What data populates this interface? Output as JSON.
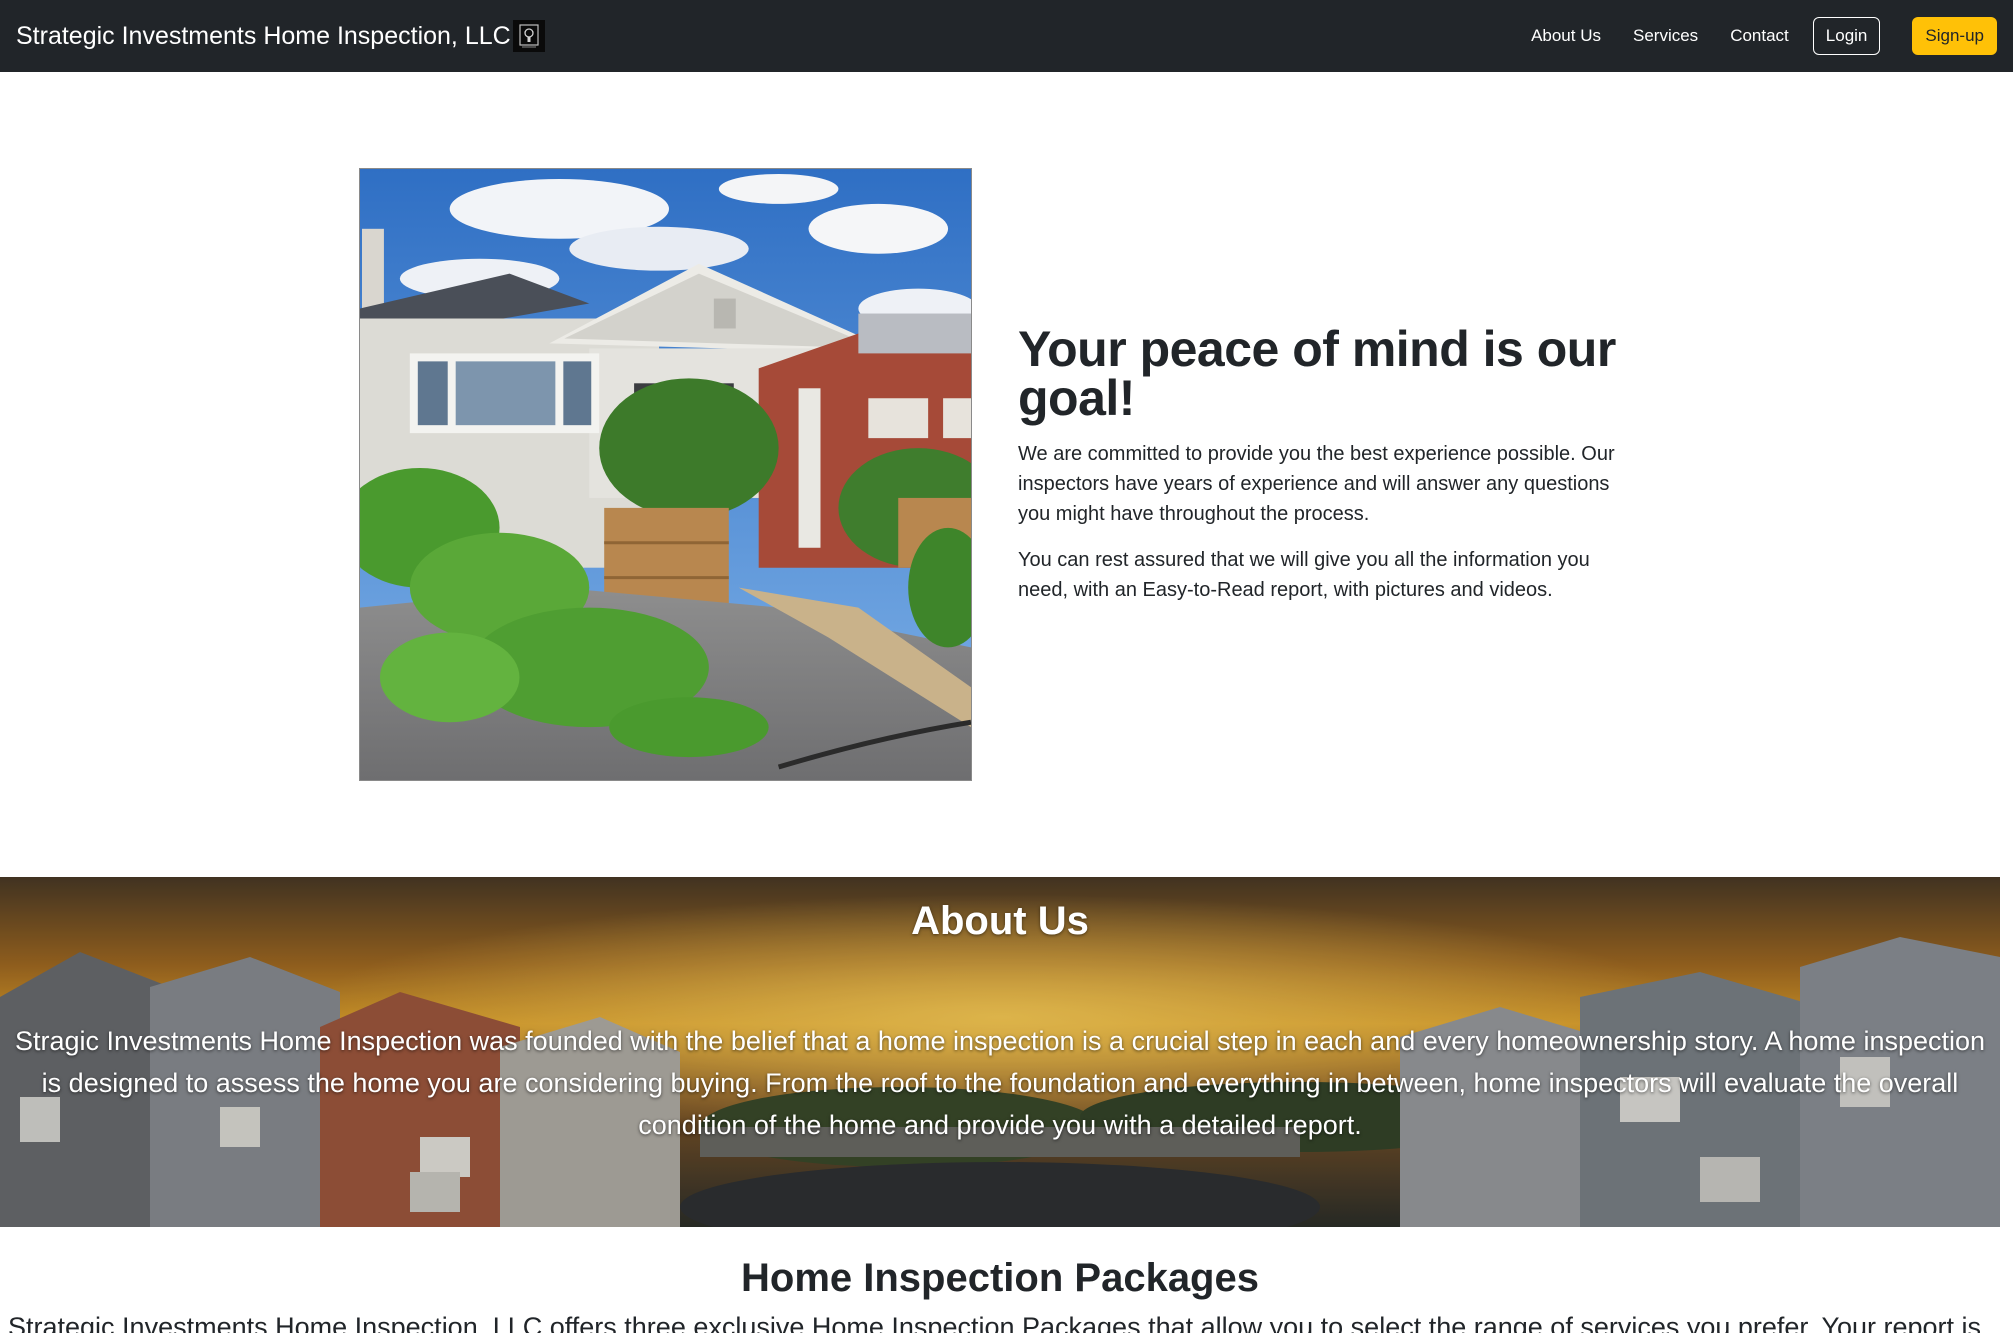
{
  "navbar": {
    "brand": "Strategic Investments Home Inspection, LLC",
    "links": [
      "About Us",
      "Services",
      "Contact"
    ],
    "login_label": "Login",
    "signup_label": "Sign-up",
    "signup_color": "#ffc107",
    "bg_color": "#212529"
  },
  "hero": {
    "title": "Your peace of mind is our goal!",
    "paragraphs": [
      "We are committed to provide you the best experience possible. Our inspectors have years of experience and will answer any questions you might have throughout the process.",
      "You can rest assured that we will give you all the information you need, with an Easy-to-Read report, with pictures and videos."
    ],
    "image_icon": "house-garden-photo"
  },
  "about": {
    "title": "About Us",
    "text": "Stragic Investments Home Inspection was founded with the belief that a home inspection is a crucial step in each and every homeownership story. A home inspection is designed to assess the home you are considering buying. From the roof to the foundation and everything in between, home inspectors will evaluate the overall condition of the home and provide you with a detailed report.",
    "image_icon": "neighborhood-sunset-photo"
  },
  "packages": {
    "title": "Home Inspection Packages",
    "text": "Strategic Investments Home Inspection, LLC offers three exclusive Home Inspection Packages that allow you to select the range of services you prefer. Your report is"
  }
}
